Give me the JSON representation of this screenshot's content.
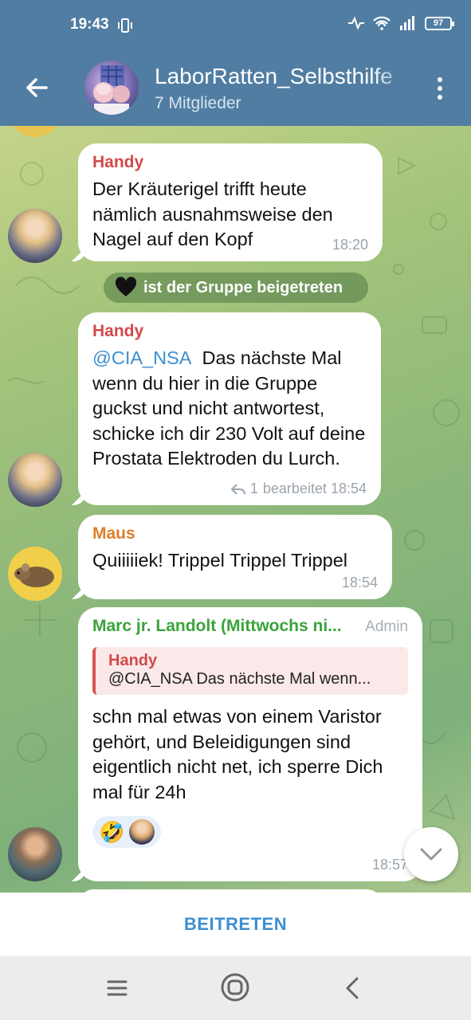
{
  "status_bar": {
    "time": "19:43",
    "battery": "97"
  },
  "header": {
    "title": "LaborRatten_Selbsthilfe",
    "subtitle": "7 Mitglieder"
  },
  "messages": [
    {
      "sender": "Handy",
      "text": "Der Kräuterigel trifft heute nämlich ausnahmsweise den Nagel auf den Kopf",
      "time": "18:20"
    },
    {
      "service_text": "ist der Gruppe beigetreten"
    },
    {
      "sender": "Handy",
      "mention": "@CIA_NSA",
      "text": "Das nächste Mal wenn du hier in die Gruppe guckst und nicht antwortest, schicke ich dir 230 Volt auf deine Prostata Elektroden du Lurch.",
      "replies": "1",
      "meta": "bearbeitet 18:54"
    },
    {
      "sender": "Maus",
      "text": "Quiiiiiek! Trippel Trippel Trippel",
      "time": "18:54"
    },
    {
      "sender": "Marc jr. Landolt (Mittwochs ni...",
      "badge": "Admin",
      "reply_to": {
        "name": "Handy",
        "text": "@CIA_NSA  Das nächste Mal wenn..."
      },
      "text": "schn mal etwas von einem Varistor gehört, und Beleidigungen sind eigentlich nicht net, ich sperre Dich mal für 24h",
      "reaction": "🤣",
      "time": "18:57"
    }
  ],
  "join_label": "BEITRETEN",
  "colors": {
    "header": "#517da2",
    "handy": "#d24a4a",
    "maus": "#e07f2a",
    "marc": "#3aa33a",
    "link": "#3d8fd1"
  },
  "icons": [
    "back-arrow-icon",
    "more-vert-icon",
    "black-heart-icon",
    "reply-arrow-icon",
    "scroll-down-icon",
    "menu-icon",
    "home-icon",
    "nav-back-icon"
  ]
}
